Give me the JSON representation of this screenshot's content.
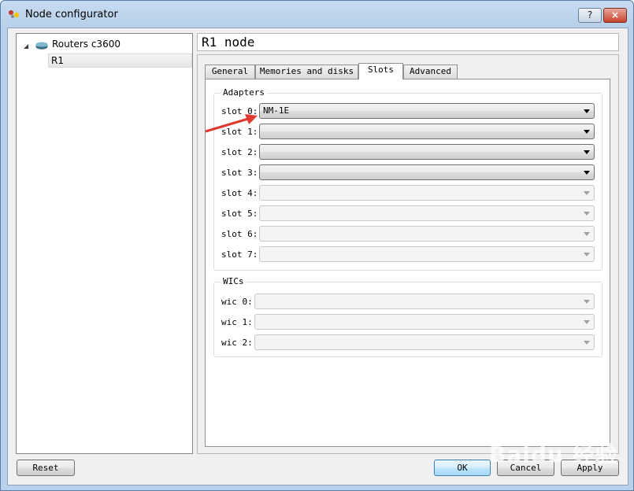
{
  "window": {
    "title": "Node configurator",
    "help_label": "?",
    "close_label": "×"
  },
  "tree": {
    "parent_label": "Routers c3600",
    "children": [
      "R1"
    ]
  },
  "node_header": "R1  node",
  "tabs": [
    "General",
    "Memories and disks",
    "Slots",
    "Advanced"
  ],
  "active_tab": "Slots",
  "adapters": {
    "title": "Adapters",
    "slots": [
      {
        "label": "slot 0:",
        "value": "NM-1E",
        "enabled": true
      },
      {
        "label": "slot 1:",
        "value": "",
        "enabled": true
      },
      {
        "label": "slot 2:",
        "value": "",
        "enabled": true
      },
      {
        "label": "slot 3:",
        "value": "",
        "enabled": true
      },
      {
        "label": "slot 4:",
        "value": "",
        "enabled": false
      },
      {
        "label": "slot 5:",
        "value": "",
        "enabled": false
      },
      {
        "label": "slot 6:",
        "value": "",
        "enabled": false
      },
      {
        "label": "slot 7:",
        "value": "",
        "enabled": false
      }
    ]
  },
  "wics": {
    "title": "WICs",
    "slots": [
      {
        "label": "wic 0:",
        "value": "",
        "enabled": false
      },
      {
        "label": "wic 1:",
        "value": "",
        "enabled": false
      },
      {
        "label": "wic 2:",
        "value": "",
        "enabled": false
      }
    ]
  },
  "buttons": {
    "reset": "Reset",
    "ok": "OK",
    "cancel": "Cancel",
    "apply": "Apply"
  },
  "watermark": "Baidu 经验",
  "colors": {
    "annotation_arrow": "#e03a2e",
    "titlebar": "#c6dbf1"
  }
}
